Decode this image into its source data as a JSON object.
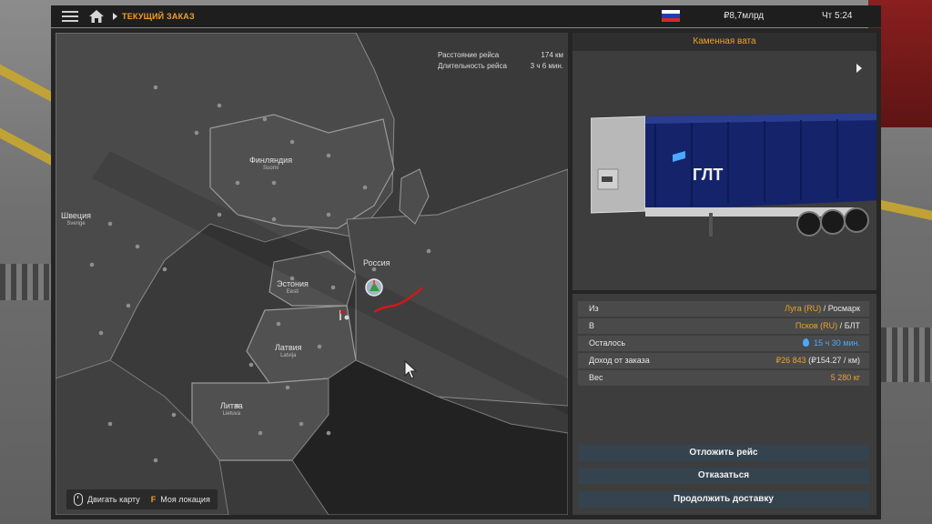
{
  "topbar": {
    "title": "ТЕКУЩИЙ ЗАКАЗ",
    "money": "₽8,7млрд",
    "clock": "Чт 5:24",
    "flag_colors": [
      "#ffffff",
      "#1b3fb5",
      "#d52b1e"
    ]
  },
  "map": {
    "stats": {
      "distance_label": "Расстояние рейса",
      "distance_value": "174 км",
      "duration_label": "Длительность рейса",
      "duration_value": "3 ч 6 мин."
    },
    "countries": [
      {
        "name": "Финляндия",
        "local": "Suomi"
      },
      {
        "name": "Швеция",
        "local": "Sverige"
      },
      {
        "name": "Россия",
        "local": ""
      },
      {
        "name": "Эстония",
        "local": "Eesti"
      },
      {
        "name": "Латвия",
        "local": "Latvija"
      },
      {
        "name": "Литва",
        "local": "Lietuva"
      }
    ],
    "footer": {
      "move_label": "Двигать карту",
      "location_key": "F",
      "location_label": "Моя локация"
    }
  },
  "cargo": {
    "title": "Каменная вата",
    "trailer_brand": "ГЛТ"
  },
  "details": {
    "from_label": "Из",
    "from_city": "Луга (RU)",
    "from_company": "Росмарк",
    "to_label": "В",
    "to_city": "Псков (RU)",
    "to_company": "БЛТ",
    "remaining_label": "Осталось",
    "remaining_value": "15 ч 30 мин.",
    "income_label": "Доход от заказа",
    "income_value": "₽26 843",
    "income_rate": "(₽154.27 / км)",
    "weight_label": "Вес",
    "weight_value": "5 280 кг",
    "separator": "/"
  },
  "buttons": {
    "postpone": "Отложить рейс",
    "cancel": "Отказаться",
    "continue": "Продолжить доставку"
  },
  "colors": {
    "accent": "#f0a02a",
    "time_blue": "#4aa8ff",
    "route_red": "#d01818"
  }
}
